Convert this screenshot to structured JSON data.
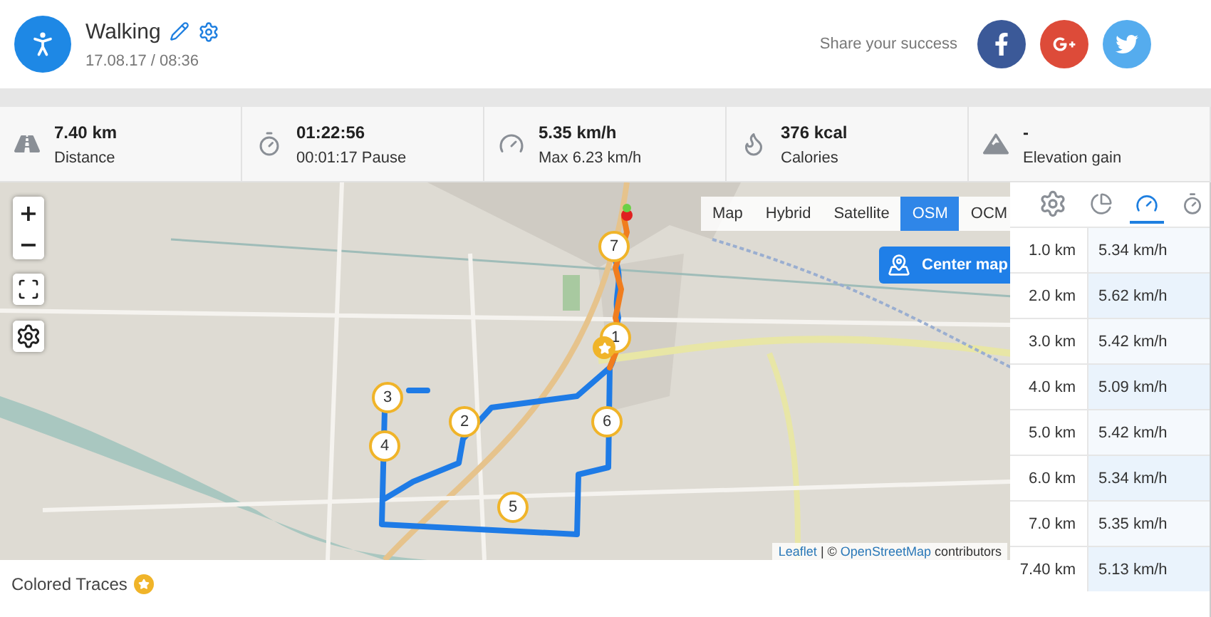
{
  "activity": {
    "title": "Walking",
    "datetime": "17.08.17 / 08:36"
  },
  "share": {
    "label": "Share your success",
    "networks": [
      {
        "kind": "facebook"
      },
      {
        "kind": "googleplus"
      },
      {
        "kind": "twitter"
      }
    ]
  },
  "stats": [
    {
      "kind": "distance",
      "value": "7.40 km",
      "label": "Distance"
    },
    {
      "kind": "duration",
      "value": "01:22:56",
      "label": "00:01:17 Pause"
    },
    {
      "kind": "speed",
      "value": "5.35 km/h",
      "label": "Max 6.23 km/h"
    },
    {
      "kind": "calories",
      "value": "376 kcal",
      "label": "Calories"
    },
    {
      "kind": "elevation",
      "value": "-",
      "label": "Elevation gain"
    }
  ],
  "map": {
    "layers": [
      {
        "label": "Map",
        "selected": false
      },
      {
        "label": "Hybrid",
        "selected": false
      },
      {
        "label": "Satellite",
        "selected": false
      },
      {
        "label": "OSM",
        "selected": true
      },
      {
        "label": "OCM",
        "selected": false
      }
    ],
    "zoom_in": "+",
    "zoom_out": "−",
    "center_button": "Center map",
    "markers": [
      "7",
      "1",
      "6",
      "2",
      "3",
      "4",
      "5"
    ],
    "attribution": {
      "link_1": "Leaflet",
      "separator": "| ©",
      "link_2": "OpenStreetMap",
      "suffix": "contributors"
    }
  },
  "footer": {
    "label": "Colored Traces"
  },
  "splits": {
    "tabs": [
      {
        "kind": "settings",
        "selected": false
      },
      {
        "kind": "pace",
        "selected": false
      },
      {
        "kind": "speed",
        "selected": true
      },
      {
        "kind": "time",
        "selected": false
      }
    ],
    "rows": [
      {
        "distance": "1.0 km",
        "speed": "5.34 km/h"
      },
      {
        "distance": "2.0 km",
        "speed": "5.62 km/h"
      },
      {
        "distance": "3.0 km",
        "speed": "5.42 km/h"
      },
      {
        "distance": "4.0 km",
        "speed": "5.09 km/h"
      },
      {
        "distance": "5.0 km",
        "speed": "5.42 km/h"
      },
      {
        "distance": "6.0 km",
        "speed": "5.34 km/h"
      },
      {
        "distance": "7.0 km",
        "speed": "5.35 km/h"
      },
      {
        "distance": "7.40 km",
        "speed": "5.13 km/h"
      }
    ]
  }
}
